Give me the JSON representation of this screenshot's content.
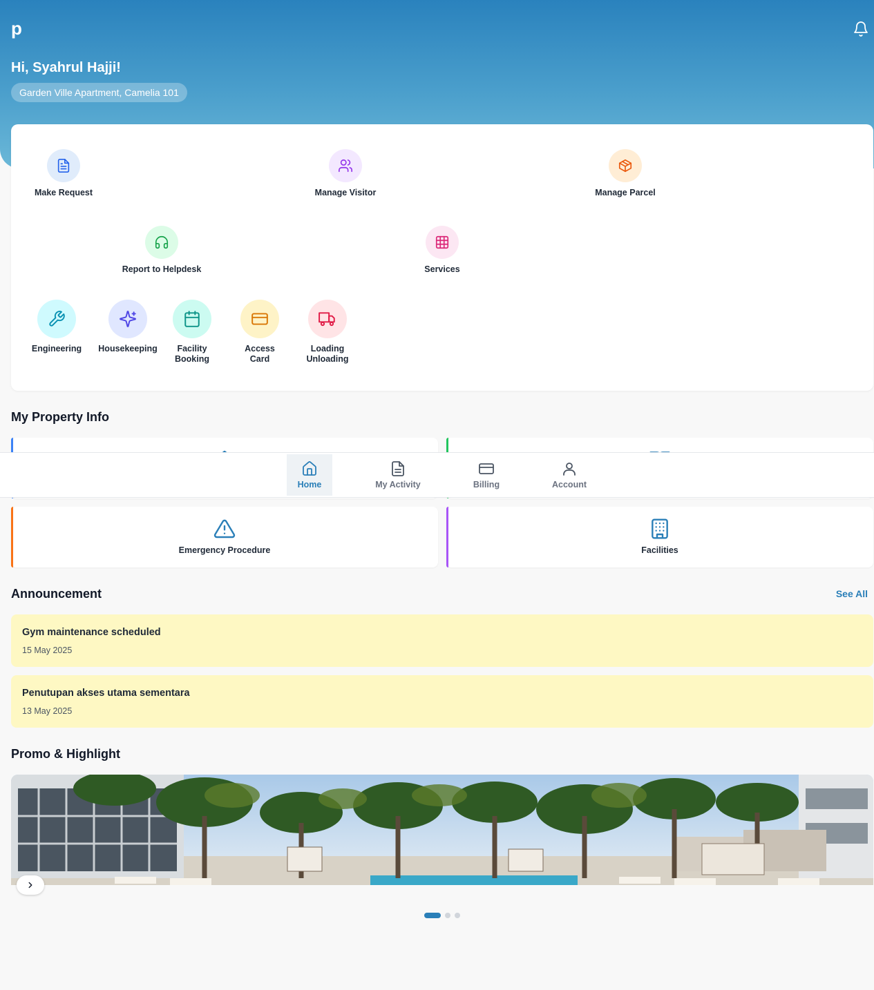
{
  "header": {
    "logo": "p",
    "greeting": "Hi, Syahrul Hajji!",
    "location": "Garden Ville Apartment, Camelia 101"
  },
  "quick_actions": [
    {
      "label": "Make Request",
      "icon": "file-text-icon",
      "color": "#2563eb",
      "bg": "#e0ecfb"
    },
    {
      "label": "Manage Visitor",
      "icon": "users-icon",
      "color": "#9333ea",
      "bg": "#f3e8ff"
    },
    {
      "label": "Manage Parcel",
      "icon": "package-icon",
      "color": "#ea580c",
      "bg": "#ffedd5"
    },
    {
      "label": "Report to Helpdesk",
      "icon": "headphones-icon",
      "color": "#16a34a",
      "bg": "#dcfce7"
    },
    {
      "label": "Services",
      "icon": "grid-icon",
      "color": "#db2777",
      "bg": "#fce7f3"
    }
  ],
  "services": [
    {
      "label": "Engineering",
      "icon": "wrench-icon",
      "color": "#0891b2",
      "bg": "#cffafe"
    },
    {
      "label": "Housekeeping",
      "icon": "sparkles-icon",
      "color": "#4f46e5",
      "bg": "#e0e7ff"
    },
    {
      "label": "Facility Booking",
      "icon": "calendar-icon",
      "color": "#0d9488",
      "bg": "#ccfbf1"
    },
    {
      "label": "Access Card",
      "icon": "credit-card-icon",
      "color": "#d97706",
      "bg": "#fef3c7"
    },
    {
      "label": "Loading Unloading",
      "icon": "truck-icon",
      "color": "#e11d48",
      "bg": "#ffe4e6"
    }
  ],
  "property_info": {
    "title": "My Property Info",
    "cards": [
      {
        "label": "",
        "icon": "home-icon",
        "accent": "#3b82f6"
      },
      {
        "label": "",
        "icon": "book-icon",
        "accent": "#22c55e"
      },
      {
        "label": "Emergency Procedure",
        "icon": "alert-triangle-icon",
        "accent": "#f97316"
      },
      {
        "label": "Facilities",
        "icon": "building-icon",
        "accent": "#a855f7"
      }
    ]
  },
  "nav": {
    "items": [
      {
        "label": "Home",
        "icon": "home-icon",
        "active": true
      },
      {
        "label": "My Activity",
        "icon": "file-text-icon",
        "active": false
      },
      {
        "label": "Billing",
        "icon": "credit-card-icon",
        "active": false
      },
      {
        "label": "Account",
        "icon": "user-icon",
        "active": false
      }
    ]
  },
  "announcement": {
    "title": "Announcement",
    "see_all": "See All",
    "items": [
      {
        "title": "Gym maintenance scheduled",
        "date": "15 May 2025"
      },
      {
        "title": "Penutupan akses utama sementara",
        "date": "13 May 2025"
      }
    ]
  },
  "promo": {
    "title": "Promo & Highlight",
    "slides": 3,
    "active_slide": 1
  },
  "colors": {
    "brand": "#2a7fb8",
    "announcement_bg": "#fef8c3"
  }
}
